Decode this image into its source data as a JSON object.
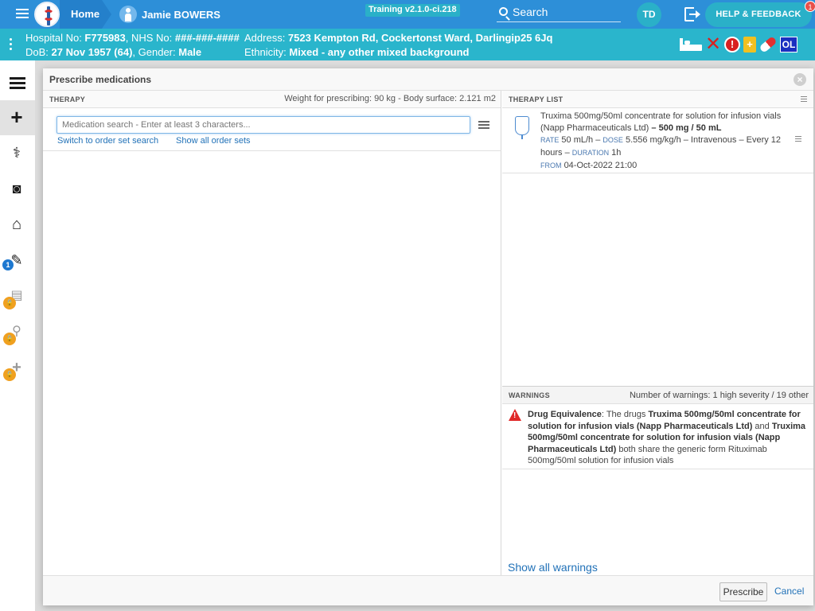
{
  "topbar": {
    "home_label": "Home",
    "patient_name": "Jamie BOWERS",
    "version": "Training v2.1.0-ci.218",
    "search_label": "Search",
    "user_initials": "TD",
    "help_label": "HELP & FEEDBACK",
    "help_badge": "1"
  },
  "banner": {
    "line1_prefix": "Hospital No: ",
    "hospital_no": "F775983",
    "nhs_prefix": ", NHS No: ",
    "nhs_no": "###-###-####",
    "line2_prefix": "DoB: ",
    "dob": "27 Nov 1957 (64)",
    "gender_prefix": ", Gender: ",
    "gender": "Male",
    "address_prefix": "Address: ",
    "address": "7523 Kempton Rd, Cockertonst Ward, Darlingip25 6Jq",
    "ethnicity_prefix": "Ethnicity: ",
    "ethnicity": "Mixed - any other mixed background",
    "icons": [
      "bed-icon",
      "x-icon",
      "alert-icon",
      "clipboard-icon",
      "pill-icon",
      "ol-icon"
    ],
    "ol_label": "OL"
  },
  "sidebar": {
    "items": [
      {
        "icon": "list-icon",
        "active": false
      },
      {
        "icon": "plus-icon",
        "active": true
      },
      {
        "icon": "stethoscope-icon",
        "active": false
      },
      {
        "icon": "camera-icon",
        "active": false
      },
      {
        "icon": "home-icon",
        "active": false
      },
      {
        "icon": "edit-doc-icon",
        "badge": "1"
      },
      {
        "icon": "clipboard-lock-icon",
        "locked": true
      },
      {
        "icon": "walking-lock-icon",
        "locked": true
      },
      {
        "icon": "plus-lock-icon",
        "locked": true
      }
    ]
  },
  "modal": {
    "title": "Prescribe medications",
    "therapy": {
      "header": "THERAPY",
      "weight_info": "Weight for prescribing: 90 kg - Body surface: 2.121 m2",
      "search_placeholder": "Medication search - Enter at least 3 characters...",
      "order_set_link": "Switch to order set search",
      "all_order_sets_link": "Show all order sets"
    },
    "therapy_list": {
      "header": "THERAPY LIST",
      "item": {
        "name_line1": "Truxima 500mg/50ml concentrate for solution for infusion vials",
        "name_line2": "(Napp Pharmaceuticals Ltd)",
        "dose_sep": " – ",
        "dose": "500 mg / 50 mL",
        "rate_tag": "RATE",
        "rate": "50 mL/h",
        "dose_tag": "DOSE",
        "dose_rate": "5.556 mg/kg/h",
        "route_freq": "– Intravenous – Every 12",
        "hours": "hours –",
        "duration_tag": "DURATION",
        "duration": "1h",
        "from_tag": "FROM",
        "from": "04-Oct-2022 21:00"
      }
    },
    "warnings": {
      "header": "WARNINGS",
      "summary": "Number of warnings: 1 high severity / 19 other",
      "item": {
        "title": "Drug Equivalence",
        "t1": ": The drugs ",
        "drug1": "Truxima 500mg/50ml concentrate for solution for infusion vials (Napp Pharmaceuticals Ltd)",
        "t2": " and ",
        "drug2": "Truxima 500mg/50ml concentrate for solution for infusion vials (Napp Pharmaceuticals Ltd)",
        "t3": " both share the generic form Rituximab 500mg/50ml solution for infusion vials"
      },
      "show_all": "Show all warnings"
    },
    "footer": {
      "prescribe": "Prescribe",
      "cancel": "Cancel"
    }
  },
  "colors": {
    "topbar": "#2d8fd8",
    "banner": "#2ab5cc",
    "link": "#2272b8",
    "warning": "#e02828"
  }
}
